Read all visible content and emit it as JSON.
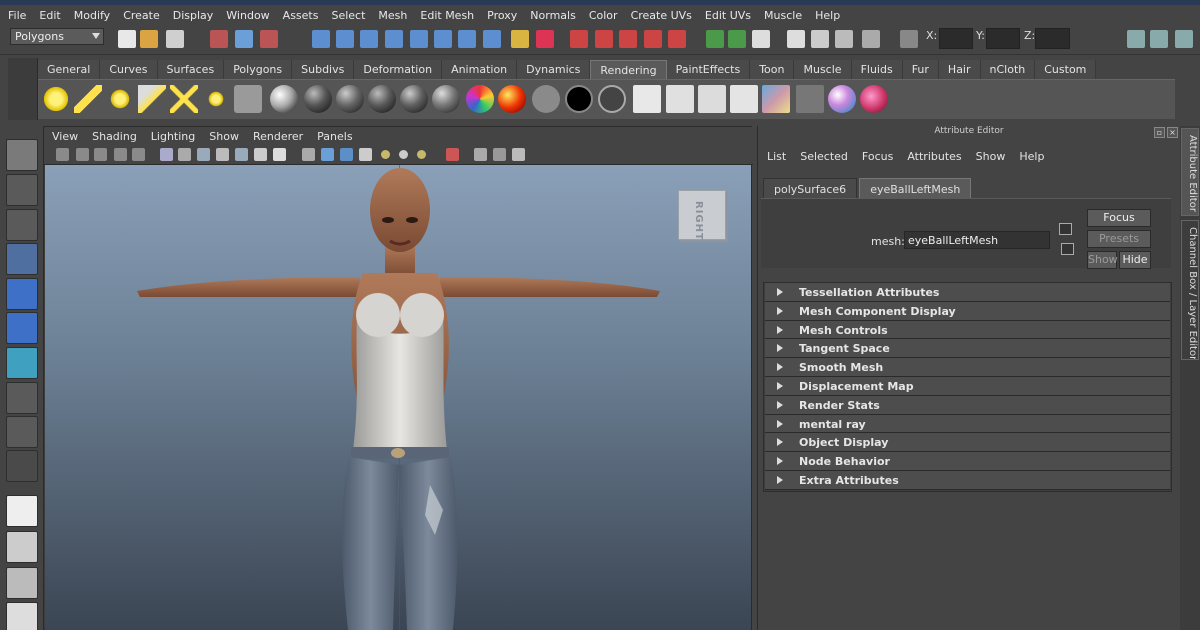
{
  "menubar": [
    "File",
    "Edit",
    "Modify",
    "Create",
    "Display",
    "Window",
    "Assets",
    "Select",
    "Mesh",
    "Edit Mesh",
    "Proxy",
    "Normals",
    "Color",
    "Create UVs",
    "Edit UVs",
    "Muscle",
    "Help"
  ],
  "status": {
    "mode": "Polygons",
    "x_label": "X:",
    "y_label": "Y:",
    "z_label": "Z:"
  },
  "shelf_tabs": [
    "General",
    "Curves",
    "Surfaces",
    "Polygons",
    "Subdivs",
    "Deformation",
    "Animation",
    "Dynamics",
    "Rendering",
    "PaintEffects",
    "Toon",
    "Muscle",
    "Fluids",
    "Fur",
    "Hair",
    "nCloth",
    "Custom"
  ],
  "shelf_active": "Rendering",
  "viewport": {
    "menu": [
      "View",
      "Shading",
      "Lighting",
      "Show",
      "Renderer",
      "Panels"
    ],
    "viewcube_label": "RIGHT"
  },
  "attr_editor": {
    "title": "Attribute Editor",
    "menu": [
      "List",
      "Selected",
      "Focus",
      "Attributes",
      "Show",
      "Help"
    ],
    "tabs": [
      "polySurface6",
      "eyeBallLeftMesh"
    ],
    "active_tab": "eyeBallLeftMesh",
    "mesh_label": "mesh:",
    "mesh_value": "eyeBallLeftMesh",
    "focus_btn": "Focus",
    "presets_btn": "Presets",
    "show_btn": "Show",
    "hide_btn": "Hide",
    "sections": [
      "Tessellation Attributes",
      "Mesh Component Display",
      "Mesh Controls",
      "Tangent Space",
      "Smooth Mesh",
      "Displacement Map",
      "Render Stats",
      "mental ray",
      "Object Display",
      "Node Behavior",
      "Extra Attributes"
    ]
  },
  "side_tabs": [
    "Attribute Editor",
    "Channel Box / Layer Editor"
  ],
  "colors": {
    "panel_bg": "#444444",
    "viewport_top": "#8aa0b8",
    "viewport_bottom": "#3b4553",
    "active_tab": "#5a5a5a"
  }
}
